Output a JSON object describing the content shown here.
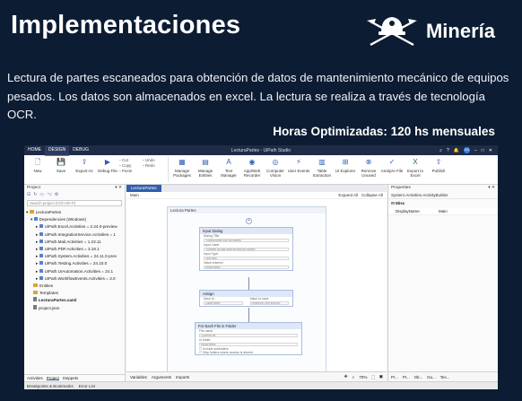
{
  "slide": {
    "title": "Implementaciones",
    "brand": "Minería",
    "description": "Lectura de partes escaneados para obtención de datos de mantenimiento mecánico de equipos pesados. Los datos son almacenados en excel. La lectura se realiza a través de tecnología OCR.",
    "hours": "Horas Optimizadas: 120 hs mensuales"
  },
  "studio": {
    "menu_tabs": [
      "HOME",
      "DESIGN",
      "DEBUG"
    ],
    "window_title": "LecturaPartes - UiPath Studio",
    "avatar": "EA",
    "ribbon": {
      "new": "New",
      "save": "Save",
      "export": "Export As",
      "debug": "Debug File",
      "cut": "Cut",
      "copy": "Copy",
      "paste": "Paste",
      "undo": "Undo",
      "redo": "Redo",
      "manage_packages": "Manage Packages",
      "manage_entities": "Manage Entities",
      "text_manager": "Text Manager",
      "appweb_recorder": "App/Web Recorder",
      "computer_vision": "Computer Vision",
      "user_events": "User Events",
      "table_extraction": "Table Extraction",
      "ui_explorer": "UI Explorer",
      "remove_unused": "Remove Unused",
      "analyze_file": "Analyze File",
      "export_excel": "Export to Excel",
      "publish": "Publish"
    },
    "project_panel": {
      "header": "Project",
      "search_placeholder": "Search project (Ctrl+Alt+P)",
      "root": "LecturaPartes",
      "dependencies": "Dependencies (Windows)",
      "packages": [
        "UiPath.Excel.Activities = 2.24.0-preview",
        "UiPath.IntegrationService.Activities = 1",
        "UiPath.Mail.Activities = 1.23.11",
        "UiPath.PDF.Activities = 3.18.1",
        "UiPath.System.Activities = 24.11.0-prev",
        "UiPath.Testing.Activities = 24.10.0",
        "UiPath.UIAutomation.Activities = 24.1",
        "UiPath.WorkflowEvents.Activities = 3.0"
      ],
      "folders": [
        "Entities",
        "Templates"
      ],
      "files": [
        "LecturaPartes.xaml",
        "project.json"
      ],
      "bottom_tabs": [
        "Activities",
        "Project",
        "Snippets"
      ]
    },
    "designer": {
      "doc_tab": "LecturaPartes",
      "breadcrumb": "Main",
      "expand_all": "Expand All",
      "collapse_all": "Collapse All",
      "sequence": "Lectura Partes",
      "input_dialog": {
        "title": "Input Dialog",
        "dialog_title_label": "Dialog Title",
        "dialog_title_value": "\"Seleccionar ruta de partes\"",
        "input_label_label": "Input Label",
        "input_label_value": "\"Ingrese la ruta para lectura de partes\"",
        "input_type_label": "Input Type",
        "input_type_value": "Text Box",
        "value_entered_label": "Value entered",
        "value_entered_value": "RutaPartes"
      },
      "assign": {
        "title": "Assign",
        "save_to": "Save to",
        "value_to_save": "Value to save",
        "left": "ListaPartes",
        "right": "Directory.GetFiles(Ru..."
      },
      "for_each": {
        "title": "For Each File in Folder",
        "file_label": "File name",
        "file_value": "CurrentFile",
        "folder_label": "In folder",
        "folder_value": "RutaPartes",
        "opt1": "Include subfolders",
        "opt2": "Skip folders where access is denied"
      },
      "bottom_tabs": [
        "Variables",
        "Arguments",
        "Imports"
      ],
      "zoom": "70%"
    },
    "properties_panel": {
      "header": "Properties",
      "subtitle": "System.Activities.ActivityBuilder",
      "group": "Misc",
      "rows": [
        {
          "name": "DisplayName",
          "value": "Main"
        }
      ],
      "bottom_tabs": [
        "Pr...",
        "Pr...",
        "Ob...",
        "Ou...",
        "Tes..."
      ]
    },
    "status_bar": [
      "Breakpoints & Bookmarks",
      "Error List"
    ]
  },
  "colors": {
    "background": "#0c1c33",
    "accent": "#e55b1f",
    "studio_title": "#1f2b47"
  }
}
